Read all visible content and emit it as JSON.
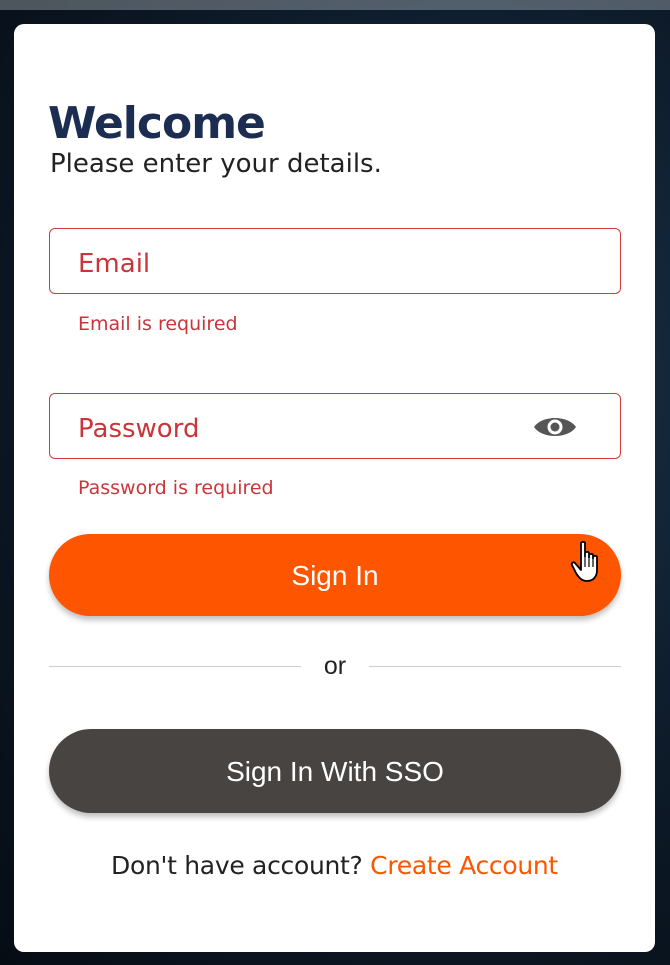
{
  "login": {
    "title": "Welcome",
    "subtitle": "Please enter your details.",
    "email": {
      "placeholder": "Email",
      "value": "",
      "error": "Email is required"
    },
    "password": {
      "placeholder": "Password",
      "value": "",
      "error": "Password is required",
      "toggle_icon": "eye-icon"
    },
    "signin_label": "Sign In",
    "divider_label": "or",
    "sso_label": "Sign In With SSO",
    "footer": {
      "question": "Don't have account?",
      "link": "Create Account"
    }
  },
  "colors": {
    "title": "#1c2d52",
    "error": "#c9353a",
    "primary": "#fd5500",
    "secondary": "#474442",
    "background": "#0d1a28"
  }
}
